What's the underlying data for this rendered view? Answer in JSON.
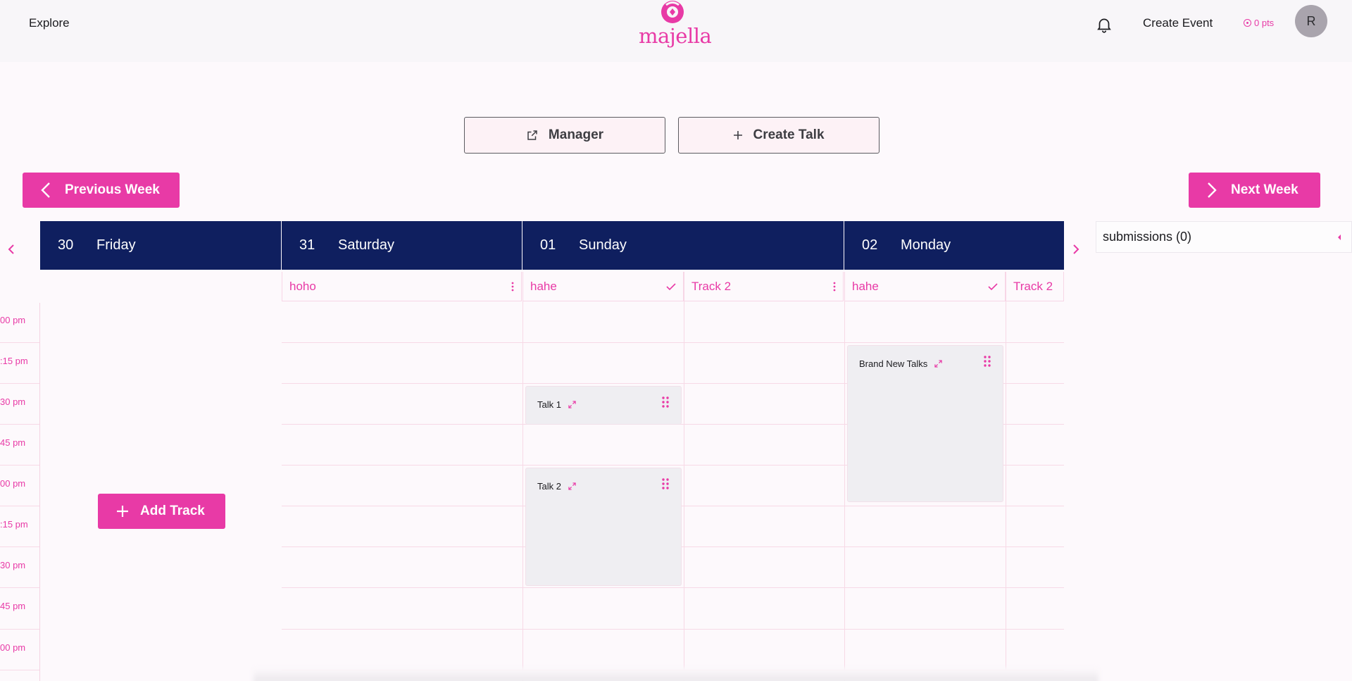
{
  "header": {
    "explore_label": "Explore",
    "logo_text": "majella",
    "create_event_label": "Create Event",
    "points_label": "0 pts",
    "avatar_initial": "R"
  },
  "actions": {
    "manager_label": "Manager",
    "create_talk_label": "Create Talk"
  },
  "nav": {
    "previous_week_label": "Previous Week",
    "next_week_label": "Next Week"
  },
  "days": [
    {
      "num": "30",
      "name": "Friday"
    },
    {
      "num": "31",
      "name": "Saturday"
    },
    {
      "num": "01",
      "name": "Sunday"
    },
    {
      "num": "02",
      "name": "Monday"
    }
  ],
  "tracks": [
    {
      "name": "hoho",
      "icon": "kebab-menu-icon"
    },
    {
      "name": "hahe",
      "icon": "check-icon"
    },
    {
      "name": "Track 2",
      "icon": "kebab-menu-icon"
    },
    {
      "name": "hahe",
      "icon": "check-icon"
    },
    {
      "name": "Track 2",
      "icon": ""
    }
  ],
  "add_track_label": "Add Track",
  "time_labels": [
    "00 pm",
    ":15 pm",
    "30 pm",
    "45 pm",
    "00 pm",
    ":15 pm",
    "30 pm",
    "45 pm",
    "00 pm"
  ],
  "talks": [
    {
      "title": "Talk 1"
    },
    {
      "title": "Talk 2"
    },
    {
      "title": "Brand New Talks"
    }
  ],
  "submissions_label": "submissions (0)",
  "colors": {
    "accent": "#e83aa6",
    "header_navy": "#0f1f5f",
    "background": "#fdf9fc"
  }
}
